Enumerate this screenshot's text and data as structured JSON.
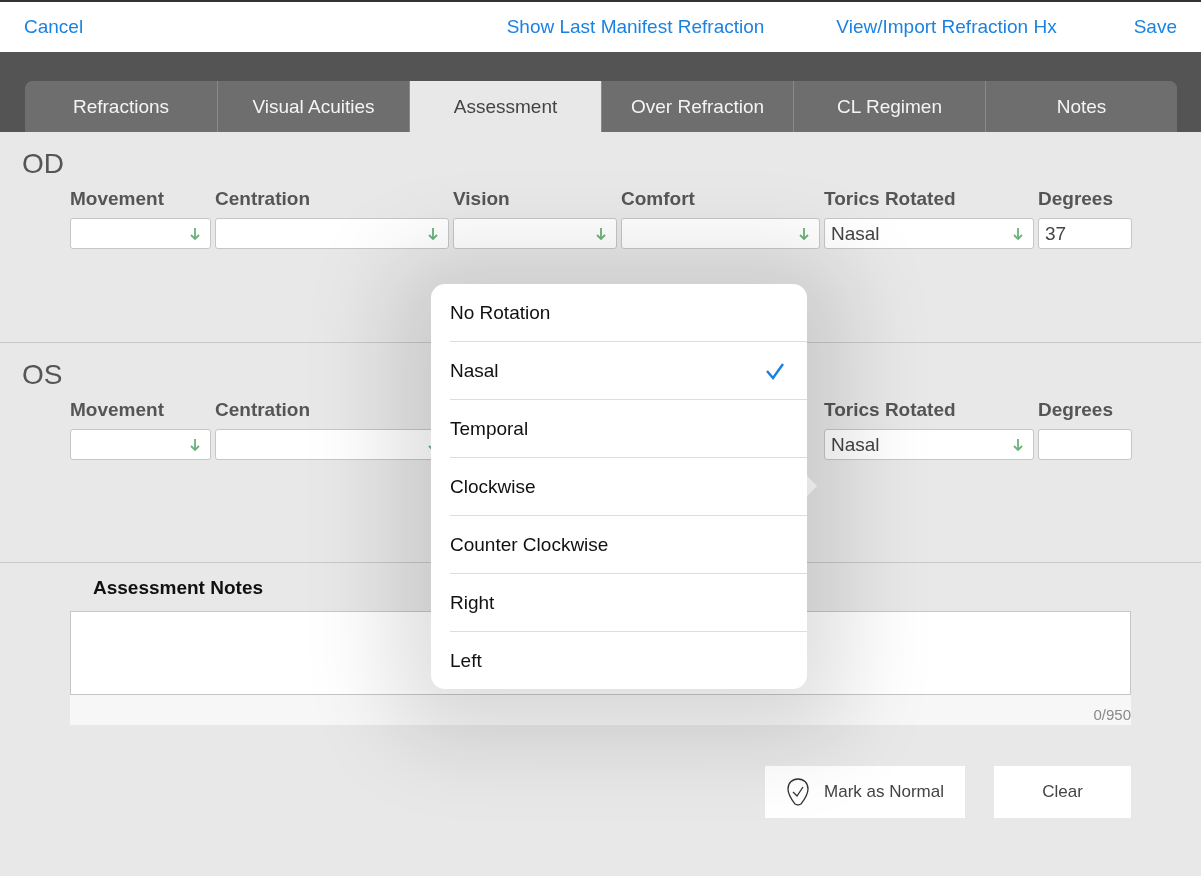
{
  "top_bar": {
    "cancel": "Cancel",
    "links": [
      "Show Last Manifest Refraction",
      "View/Import Refraction Hx"
    ],
    "save": "Save"
  },
  "tabs": [
    {
      "label": "Refractions",
      "selected": false
    },
    {
      "label": "Visual Acuities",
      "selected": false
    },
    {
      "label": "Assessment",
      "selected": true
    },
    {
      "label": "Over Refraction",
      "selected": false
    },
    {
      "label": "CL Regimen",
      "selected": false
    },
    {
      "label": "Notes",
      "selected": false
    }
  ],
  "sections": [
    {
      "title": "OD",
      "columns": [
        {
          "kind": "select",
          "label": "Movement"
        },
        {
          "kind": "select",
          "label": "Centration"
        },
        {
          "kind": "select",
          "label": "Vision"
        },
        {
          "kind": "select",
          "label": "Comfort"
        },
        {
          "kind": "select",
          "label": "Torics Rotated",
          "value": "Nasal"
        },
        {
          "kind": "text",
          "label": "Degrees",
          "value": "37"
        }
      ]
    },
    {
      "title": "OS",
      "columns": [
        {
          "kind": "select",
          "label": "Movement"
        },
        {
          "kind": "select",
          "label": "Centration"
        },
        {
          "kind": "covered"
        },
        {
          "kind": "covered"
        },
        {
          "kind": "select",
          "label": "Torics Rotated",
          "value": "Nasal"
        },
        {
          "kind": "text",
          "label": "Degrees"
        }
      ]
    }
  ],
  "notes": {
    "label": "Assessment Notes",
    "counter": "0/950"
  },
  "buttons": {
    "mark_normal": "Mark as Normal",
    "clear": "Clear"
  },
  "popover": {
    "options": [
      {
        "label": "No Rotation",
        "selected": false
      },
      {
        "label": "Nasal",
        "selected": true
      },
      {
        "label": "Temporal",
        "selected": false
      },
      {
        "label": "Clockwise",
        "selected": false
      },
      {
        "label": "Counter Clockwise",
        "selected": false
      },
      {
        "label": "Right",
        "selected": false
      },
      {
        "label": "Left",
        "selected": false
      }
    ]
  }
}
